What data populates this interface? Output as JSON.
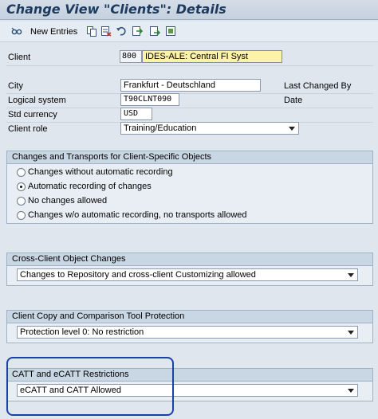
{
  "window": {
    "title": "Change View \"Clients\": Details"
  },
  "toolbar": {
    "new_entries_label": "New Entries",
    "icons": [
      "glasses-icon",
      "copy-icon",
      "delete-icon",
      "undo-icon",
      "select-all-icon",
      "select-block-icon",
      "deselect-icon"
    ]
  },
  "fields": {
    "client_label": "Client",
    "client_number": "800",
    "client_name": "IDES-ALE: Central FI Syst",
    "city_label": "City",
    "city_value": "Frankfurt - Deutschland",
    "last_changed_by_label": "Last Changed By",
    "logical_system_label": "Logical system",
    "logical_system_value": "T90CLNT090",
    "date_label": "Date",
    "std_currency_label": "Std currency",
    "std_currency_value": "USD",
    "client_role_label": "Client role",
    "client_role_value": "Training/Education"
  },
  "changes_group": {
    "title": "Changes and Transports for Client-Specific Objects",
    "options": [
      {
        "label": "Changes without automatic recording",
        "selected": false
      },
      {
        "label": "Automatic recording of changes",
        "selected": true
      },
      {
        "label": "No changes allowed",
        "selected": false
      },
      {
        "label": "Changes w/o automatic recording, no transports allowed",
        "selected": false
      }
    ]
  },
  "cross_client_group": {
    "title": "Cross-Client Object Changes",
    "value": "Changes to Repository and cross-client Customizing allowed"
  },
  "copy_group": {
    "title": "Client Copy and Comparison Tool Protection",
    "value": "Protection level 0: No restriction"
  },
  "catt_group": {
    "title": "CATT and eCATT Restrictions",
    "value": "eCATT and CATT Allowed"
  },
  "colors": {
    "title_text": "#1d3a5e",
    "highlight_field": "#fdf3a8",
    "annotation": "#1f3fa8"
  }
}
